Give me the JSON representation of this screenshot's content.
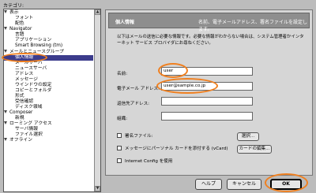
{
  "category_label": "カテゴリ:",
  "sidebar": {
    "items": [
      {
        "label": "表示"
      },
      {
        "label": "フォント"
      },
      {
        "label": "配色"
      },
      {
        "label": "Navigator"
      },
      {
        "label": "言語"
      },
      {
        "label": "アプリケーション"
      },
      {
        "label": "Smart Browsing (tm)"
      },
      {
        "label": "メールとニュースグループ"
      },
      {
        "label": "個人情報"
      },
      {
        "label": "メールサーバ"
      },
      {
        "label": "ニュースサーバ"
      },
      {
        "label": "アドレス"
      },
      {
        "label": "メッセージ"
      },
      {
        "label": "ウインドウの設定"
      },
      {
        "label": "コピーとフォルダ"
      },
      {
        "label": "形式"
      },
      {
        "label": "受信確認"
      },
      {
        "label": "ディスク領域"
      },
      {
        "label": "Composer"
      },
      {
        "label": "新規"
      },
      {
        "label": "ローミング アクセス"
      },
      {
        "label": "サーバ情報"
      },
      {
        "label": "ファイル選択"
      },
      {
        "label": "オフライン"
      }
    ],
    "scroll_up": "▲",
    "scroll_down": "▼"
  },
  "panel": {
    "title": "個人情報",
    "description": "名前、電子メールアドレス、署名ファイルを設定します。",
    "intro": "以下はメールの送信に必要な情報です。必要な情報がわからない場合は、システム管理者かインターネット サービス プロバイダにお尋ねください。",
    "name_label": "名前:",
    "name_value": "user",
    "email_label": "電子メール アドレス:",
    "email_value": "user@sample.co.jp",
    "reply_label": "返信先アドレス:",
    "reply_value": "",
    "org_label": "組織:",
    "org_value": "",
    "signature_label": "署名ファイル:",
    "choose_button": "選択...",
    "vcard_label": "メッセージにパーソナル カードを添付する (vCard)",
    "edit_card_button": "カードの編集...",
    "internet_config_label": "Internet Config を使用"
  },
  "buttons": {
    "help": "ヘルプ",
    "cancel": "キャンセル",
    "ok": "OK"
  },
  "colors": {
    "selection": "#3c3c8c",
    "highlight_circle": "#f08020"
  }
}
